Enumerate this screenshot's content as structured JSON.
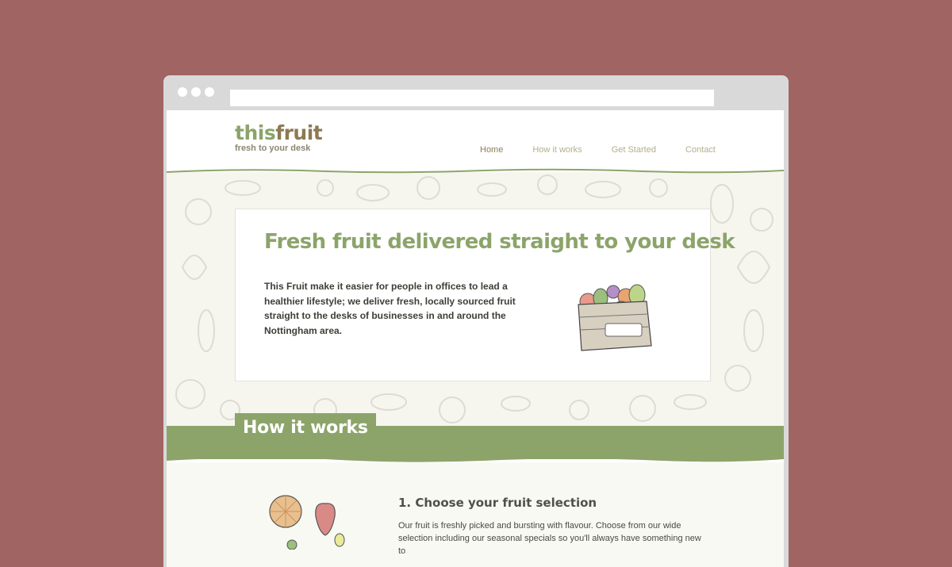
{
  "site": {
    "logo_part1": "this",
    "logo_part2": "fruit",
    "tagline": "fresh to your desk"
  },
  "nav": [
    {
      "label": "Home",
      "active": true
    },
    {
      "label": "How it works",
      "active": false
    },
    {
      "label": "Get Started",
      "active": false
    },
    {
      "label": "Contact",
      "active": false
    }
  ],
  "hero": {
    "title": "Fresh fruit delivered straight to your desk",
    "text": "This Fruit make it easier for people in offices to lead a healthier lifestyle; we deliver fresh, locally sourced fruit straight to the desks of businesses in and around the Nottingham area."
  },
  "how": {
    "heading": "How it works",
    "step1_title": "1. Choose your fruit selection",
    "step1_text": "Our fruit is freshly picked and bursting with flavour. Choose from our wide selection including our seasonal specials so you'll always have something new to"
  },
  "colors": {
    "background": "#a06462",
    "brand_green": "#8ca46a",
    "brand_brown": "#8c7a52",
    "hero_bg": "#f6f6ef"
  },
  "icons": {
    "window_dots": "window-control-icons",
    "hero_illustration": "fruit-crate-illustration",
    "step_illustration": "fruit-illustration"
  }
}
